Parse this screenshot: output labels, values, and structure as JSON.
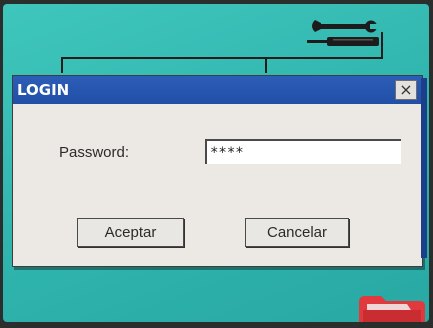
{
  "dialog": {
    "title": "LOGIN",
    "close_label": "×",
    "password_label": "Password:",
    "password_value": "****",
    "accept_label": "Aceptar",
    "cancel_label": "Cancelar"
  },
  "icons": {
    "tool": "wrench-screwdriver-icon",
    "folder": "folder-icon",
    "close": "close-icon"
  },
  "colors": {
    "screen_bg": "#33bdb5",
    "titlebar": "#2555ad",
    "dialog_bg": "#ece9e4",
    "folder": "#e03a3e"
  }
}
